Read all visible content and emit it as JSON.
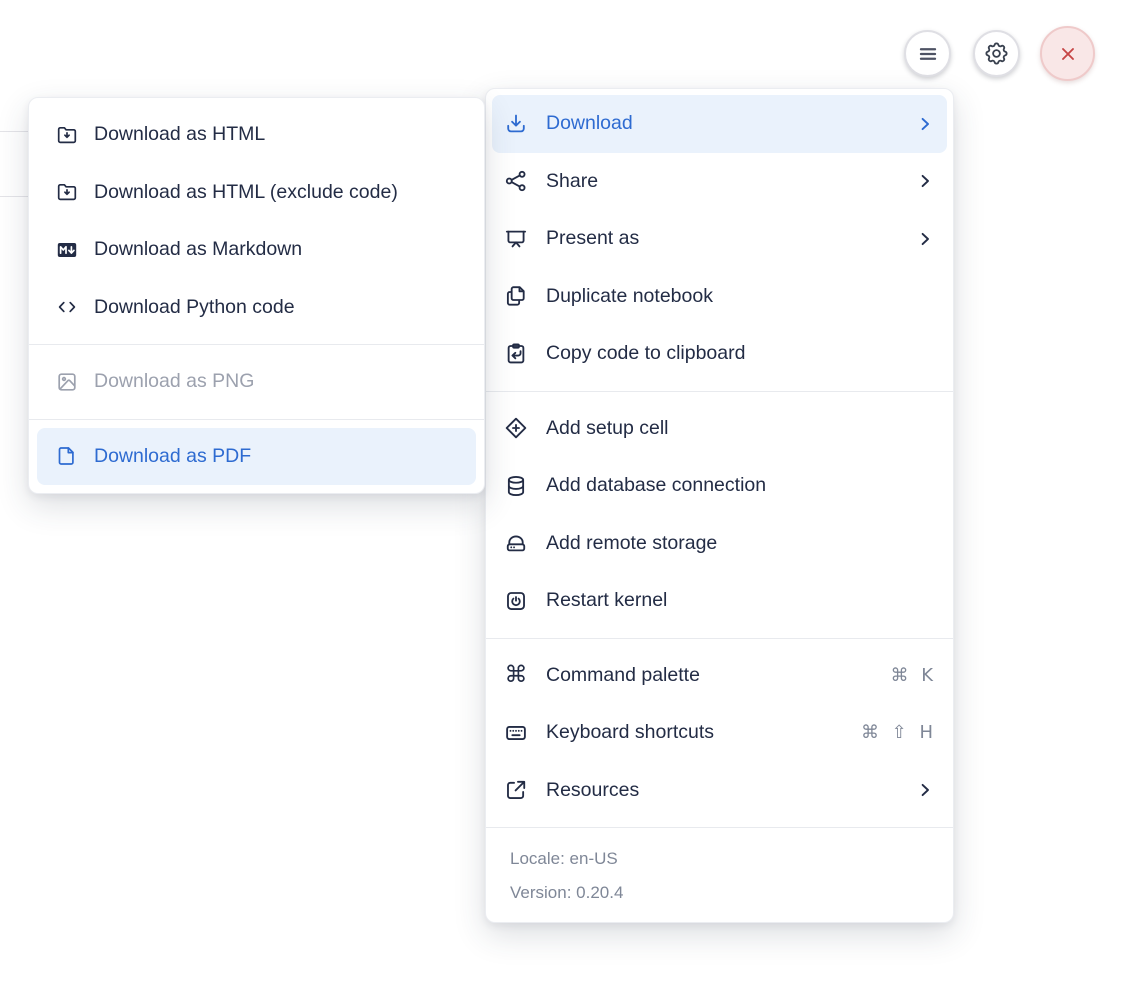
{
  "topbar": {
    "buttons": [
      {
        "name": "menu",
        "icon": "hamburger-icon"
      },
      {
        "name": "settings",
        "icon": "gear-icon"
      },
      {
        "name": "close",
        "icon": "close-icon"
      }
    ]
  },
  "download_submenu": {
    "groups": [
      {
        "items": [
          {
            "label": "Download as HTML",
            "icon": "folder-download"
          },
          {
            "label": "Download as HTML (exclude code)",
            "icon": "folder-download"
          },
          {
            "label": "Download as Markdown",
            "icon": "markdown"
          },
          {
            "label": "Download Python code",
            "icon": "code"
          }
        ]
      },
      {
        "items": [
          {
            "label": "Download as PNG",
            "icon": "image",
            "disabled": true
          }
        ]
      },
      {
        "items": [
          {
            "label": "Download as PDF",
            "icon": "file",
            "highlighted": true
          }
        ]
      }
    ]
  },
  "main_menu": {
    "groups": [
      {
        "items": [
          {
            "label": "Download",
            "icon": "download",
            "submenu": true,
            "highlighted": true
          },
          {
            "label": "Share",
            "icon": "share",
            "submenu": true
          },
          {
            "label": "Present as",
            "icon": "present",
            "submenu": true
          },
          {
            "label": "Duplicate notebook",
            "icon": "duplicate"
          },
          {
            "label": "Copy code to clipboard",
            "icon": "clipboard-arrow"
          }
        ]
      },
      {
        "items": [
          {
            "label": "Add setup cell",
            "icon": "diamond-plus"
          },
          {
            "label": "Add database connection",
            "icon": "database"
          },
          {
            "label": "Add remote storage",
            "icon": "storage"
          },
          {
            "label": "Restart kernel",
            "icon": "power"
          }
        ]
      },
      {
        "items": [
          {
            "label": "Command palette",
            "icon": "command",
            "shortcut": "⌘ K"
          },
          {
            "label": "Keyboard shortcuts",
            "icon": "keyboard",
            "shortcut": "⌘ ⇧ H"
          },
          {
            "label": "Resources",
            "icon": "external-link",
            "submenu": true
          }
        ]
      }
    ],
    "footer": {
      "locale": "Locale: en-US",
      "version": "Version: 0.20.4"
    }
  },
  "colors": {
    "accent": "#2e6bd1",
    "highlight_bg": "#eaf2fc",
    "text": "#232c45",
    "disabled": "#9ca1ae",
    "soft_gray": "#7f8797",
    "danger": "#c64545",
    "danger_bg": "#f9e7e7"
  }
}
